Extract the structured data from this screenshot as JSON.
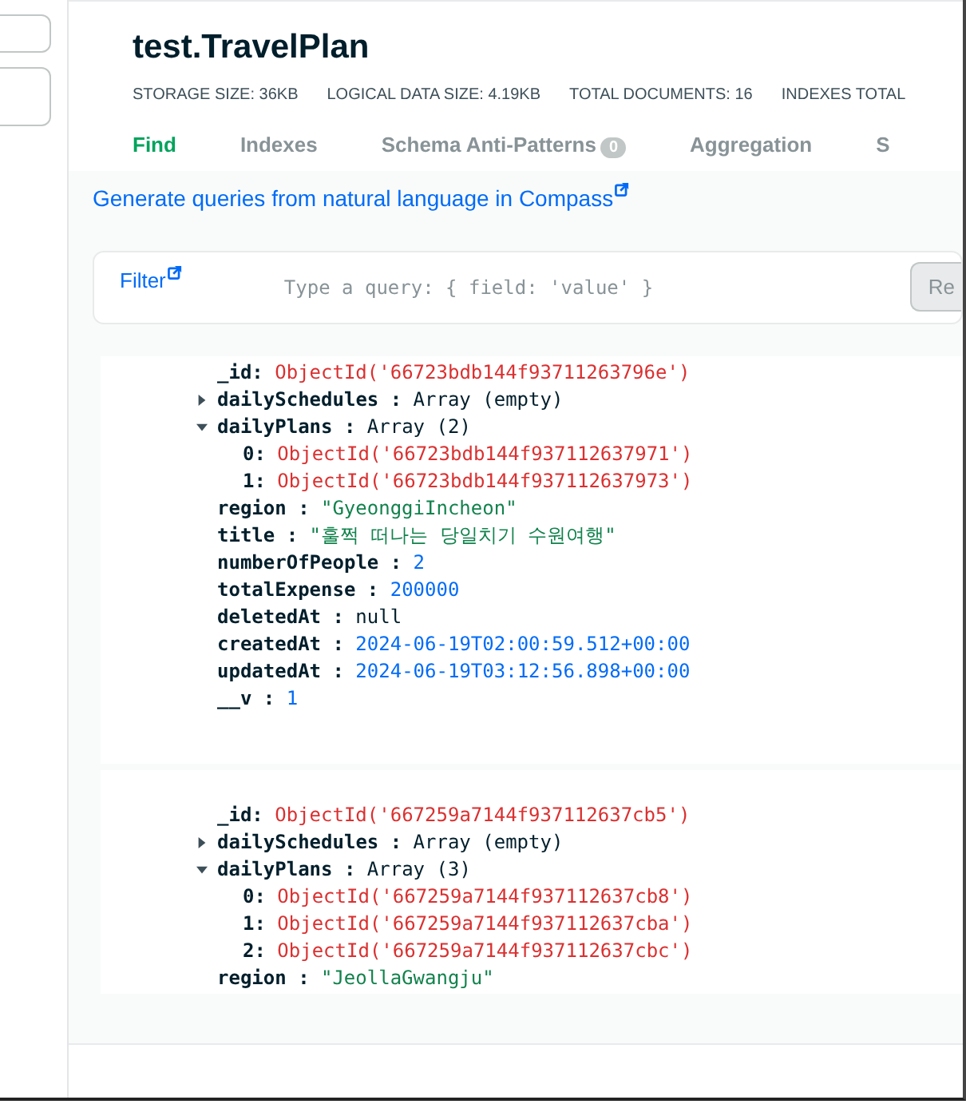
{
  "collection": {
    "title": "test.TravelPlan",
    "stats": [
      {
        "label": "STORAGE SIZE:",
        "value": "36KB"
      },
      {
        "label": "LOGICAL DATA SIZE:",
        "value": "4.19KB"
      },
      {
        "label": "TOTAL DOCUMENTS:",
        "value": "16"
      },
      {
        "label": "INDEXES TOTAL"
      }
    ]
  },
  "tabs": [
    {
      "label": "Find",
      "selected": true
    },
    {
      "label": "Indexes",
      "selected": false
    },
    {
      "label": "Schema Anti-Patterns",
      "selected": false,
      "badge": "0"
    },
    {
      "label": "Aggregation",
      "selected": false
    },
    {
      "label": "S",
      "selected": false
    }
  ],
  "nl_link": "Generate queries from natural language in Compass",
  "filter": {
    "label": "Filter",
    "placeholder": "Type a query: { field: 'value' }",
    "button": "Re"
  },
  "documents": [
    {
      "fields": [
        {
          "key": "_id:",
          "value": "ObjectId('66723bdb144f93711263796e')",
          "kind": "objectid"
        },
        {
          "key": "dailySchedules :",
          "value": "Array (empty)",
          "kind": "array",
          "expanded": false
        },
        {
          "key": "dailyPlans :",
          "value": "Array (2)",
          "kind": "array",
          "expanded": true,
          "items": [
            {
              "index": "0:",
              "value": "ObjectId('66723bdb144f937112637971')",
              "kind": "objectid"
            },
            {
              "index": "1:",
              "value": "ObjectId('66723bdb144f937112637973')",
              "kind": "objectid"
            }
          ]
        },
        {
          "key": "region :",
          "value": "\"GyeonggiIncheon\"",
          "kind": "string"
        },
        {
          "key": "title :",
          "value": "\"훌쩍 떠나는 당일치기 수원여행\"",
          "kind": "string"
        },
        {
          "key": "numberOfPeople :",
          "value": "2",
          "kind": "number"
        },
        {
          "key": "totalExpense :",
          "value": "200000",
          "kind": "number"
        },
        {
          "key": "deletedAt :",
          "value": "null",
          "kind": "null"
        },
        {
          "key": "createdAt :",
          "value": "2024-06-19T02:00:59.512+00:00",
          "kind": "date"
        },
        {
          "key": "updatedAt :",
          "value": "2024-06-19T03:12:56.898+00:00",
          "kind": "date"
        },
        {
          "key": "__v :",
          "value": "1",
          "kind": "number"
        }
      ]
    },
    {
      "fields": [
        {
          "key": "_id:",
          "value": "ObjectId('667259a7144f937112637cb5')",
          "kind": "objectid"
        },
        {
          "key": "dailySchedules :",
          "value": "Array (empty)",
          "kind": "array",
          "expanded": false
        },
        {
          "key": "dailyPlans :",
          "value": "Array (3)",
          "kind": "array",
          "expanded": true,
          "items": [
            {
              "index": "0:",
              "value": "ObjectId('667259a7144f937112637cb8')",
              "kind": "objectid"
            },
            {
              "index": "1:",
              "value": "ObjectId('667259a7144f937112637cba')",
              "kind": "objectid"
            },
            {
              "index": "2:",
              "value": "ObjectId('667259a7144f937112637cbc')",
              "kind": "objectid"
            }
          ]
        },
        {
          "key": "region :",
          "value": "\"JeollaGwangju\"",
          "kind": "string"
        }
      ]
    }
  ]
}
